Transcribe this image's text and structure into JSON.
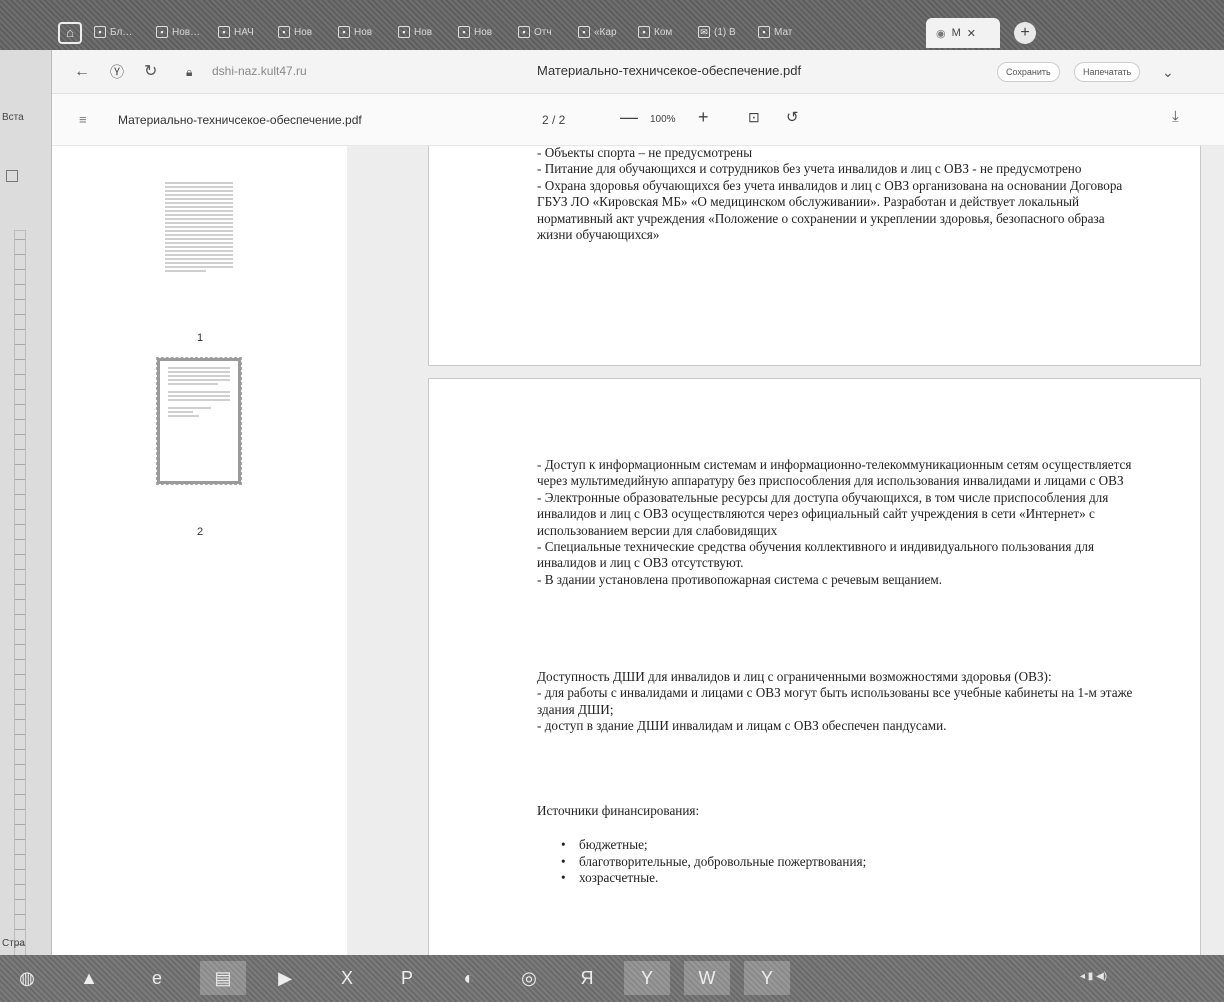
{
  "tabs": [
    {
      "label": "Бл…",
      "icon": "doc-icon"
    },
    {
      "label": "Нов…",
      "icon": "doc-icon"
    },
    {
      "label": "НАЧ",
      "icon": "doc-icon"
    },
    {
      "label": "Нов",
      "icon": "doc-icon"
    },
    {
      "label": "Нов",
      "icon": "doc-icon"
    },
    {
      "label": "Нов",
      "icon": "doc-icon"
    },
    {
      "label": "Нов",
      "icon": "doc-icon"
    },
    {
      "label": "Отч",
      "icon": "doc-icon"
    },
    {
      "label": "«Кар",
      "icon": "doc-icon"
    },
    {
      "label": "Ком",
      "icon": "doc-icon"
    },
    {
      "label": "(1) В",
      "icon": "mail-icon"
    },
    {
      "label": "Мат",
      "icon": "doc-icon"
    }
  ],
  "active_tab": {
    "label": "М"
  },
  "word": {
    "label_top": "Вста",
    "label_bottom": "Стра"
  },
  "address_bar": {
    "url": "dshi-naz.kult47.ru",
    "title": "Материально-техничсекое-обеспечение.pdf",
    "save_label": "Сохранить",
    "print_label": "Напечатать"
  },
  "pdf_toolbar": {
    "filename": "Материально-техничсекое-обеспечение.pdf",
    "page_indicator": "2 / 2",
    "zoom": "100%",
    "minus": "—",
    "plus": "+"
  },
  "thumbnails": [
    {
      "number": "1"
    },
    {
      "number": "2"
    }
  ],
  "page1": {
    "paragraphs": [
      "- Объекты спорта – не предусмотрены",
      "- Питание для обучающихся и сотрудников без учета инвалидов и лиц с ОВЗ - не предусмотрено",
      "- Охрана здоровья обучающихся без учета инвалидов и лиц с ОВЗ организована на основании Договора ГБУЗ ЛО «Кировская МБ» «О медицинском обслуживании». Разработан и действует локальный нормативный акт учреждения «Положение о сохранении и укреплении здоровья, безопасного образа жизни обучающихся»"
    ]
  },
  "page2": {
    "block1": [
      "- Доступ к информационным системам и информационно-телекоммуникационным сетям осуществляется через мультимедийную аппаратуру без приспособления для использования инвалидами и лицами с ОВЗ",
      "- Электронные образовательные ресурсы для доступа обучающихся, в том числе приспособления для инвалидов и лиц с ОВЗ осуществляются через официальный сайт учреждения в сети «Интернет» с использованием версии для слабовидящих",
      "- Специальные технические средства обучения коллективного и индивидуального пользования для инвалидов и лиц с ОВЗ отсутствуют.",
      "- В здании установлена противопожарная система с речевым вещанием."
    ],
    "block2": [
      " Доступность ДШИ для инвалидов и лиц с ограниченными возможностями здоровья (ОВЗ):",
      "- для работы с инвалидами и лицами с ОВЗ могут быть использованы все учебные кабинеты на 1-м этаже здания ДШИ;",
      "- доступ в здание ДШИ инвалидам и лицам с ОВЗ обеспечен пандусами."
    ],
    "funding_heading": "Источники финансирования:",
    "funding_items": [
      "бюджетные;",
      "благотворительные, добровольные пожертвования;",
      "хозрасчетные."
    ]
  },
  "taskbar": {
    "items": [
      "start-icon",
      "browser-icon",
      "ie-icon",
      "folder-icon",
      "media-icon",
      "excel-icon",
      "powerpoint-icon",
      "app-icon",
      "chrome-icon",
      "yandex-icon",
      "yandex-browser-icon",
      "word-icon",
      "yandex-browser-icon"
    ]
  }
}
